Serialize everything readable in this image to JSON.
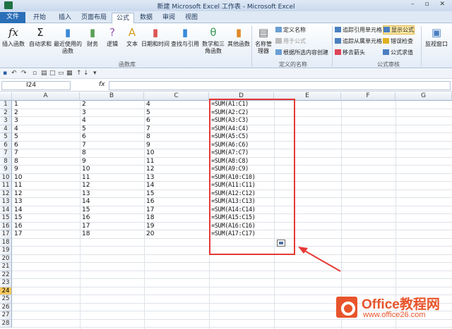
{
  "window": {
    "title": "新建 Microsoft Excel 工作表 - Microsoft Excel"
  },
  "tabs": [
    {
      "label": "文件",
      "name": "tab-file"
    },
    {
      "label": "开始",
      "name": "tab-home"
    },
    {
      "label": "插入",
      "name": "tab-insert"
    },
    {
      "label": "页面布局",
      "name": "tab-page-layout"
    },
    {
      "label": "公式",
      "name": "tab-formulas"
    },
    {
      "label": "数据",
      "name": "tab-data"
    },
    {
      "label": "审阅",
      "name": "tab-review"
    },
    {
      "label": "视图",
      "name": "tab-view"
    }
  ],
  "ribbon": {
    "insert_function": "插入函数",
    "autosum": "自动求和",
    "recent": "最近使用的函数",
    "financial": "财务",
    "logical": "逻辑",
    "text": "文本",
    "datetime": "日期和时间",
    "lookup": "查找与引用",
    "math": "数学和三角函数",
    "other": "其他函数",
    "group_library": "函数库",
    "name_manager": "名称管理器",
    "define_name": "定义名称",
    "use_in_formula": "用于公式",
    "create_from_selection": "根据所选内容创建",
    "group_names": "定义的名称",
    "trace_precedents": "追踪引用单元格",
    "trace_dependents": "追踪从属单元格",
    "remove_arrows": "移去箭头",
    "show_formulas": "显示公式",
    "error_checking": "错误检查",
    "evaluate_formula": "公式求值",
    "group_audit": "公式审核",
    "watch_window": "监视窗口"
  },
  "namebox": "I24",
  "fx": "fx",
  "columns": [
    "A",
    "B",
    "C",
    "D",
    "E",
    "F",
    "G"
  ],
  "rows": [
    {
      "n": "1",
      "a": "1",
      "b": "2",
      "c": "4",
      "d": "=SUM(A1:C1)"
    },
    {
      "n": "2",
      "a": "2",
      "b": "3",
      "c": "5",
      "d": "=SUM(A2:C2)"
    },
    {
      "n": "3",
      "a": "3",
      "b": "4",
      "c": "6",
      "d": "=SUM(A3:C3)"
    },
    {
      "n": "4",
      "a": "4",
      "b": "5",
      "c": "7",
      "d": "=SUM(A4:C4)"
    },
    {
      "n": "5",
      "a": "5",
      "b": "6",
      "c": "8",
      "d": "=SUM(A5:C5)"
    },
    {
      "n": "6",
      "a": "6",
      "b": "7",
      "c": "9",
      "d": "=SUM(A6:C6)"
    },
    {
      "n": "7",
      "a": "7",
      "b": "8",
      "c": "10",
      "d": "=SUM(A7:C7)"
    },
    {
      "n": "8",
      "a": "8",
      "b": "9",
      "c": "11",
      "d": "=SUM(A8:C8)"
    },
    {
      "n": "9",
      "a": "9",
      "b": "10",
      "c": "12",
      "d": "=SUM(A9:C9)"
    },
    {
      "n": "10",
      "a": "10",
      "b": "11",
      "c": "13",
      "d": "=SUM(A10:C10)"
    },
    {
      "n": "11",
      "a": "11",
      "b": "12",
      "c": "14",
      "d": "=SUM(A11:C11)"
    },
    {
      "n": "12",
      "a": "12",
      "b": "13",
      "c": "15",
      "d": "=SUM(A12:C12)"
    },
    {
      "n": "13",
      "a": "13",
      "b": "14",
      "c": "16",
      "d": "=SUM(A13:C13)"
    },
    {
      "n": "14",
      "a": "14",
      "b": "15",
      "c": "17",
      "d": "=SUM(A14:C14)"
    },
    {
      "n": "15",
      "a": "15",
      "b": "16",
      "c": "18",
      "d": "=SUM(A15:C15)"
    },
    {
      "n": "16",
      "a": "16",
      "b": "17",
      "c": "19",
      "d": "=SUM(A16:C16)"
    },
    {
      "n": "17",
      "a": "17",
      "b": "18",
      "c": "20",
      "d": "=SUM(A17:C17)"
    },
    {
      "n": "18",
      "a": "",
      "b": "",
      "c": "",
      "d": ""
    },
    {
      "n": "19",
      "a": "",
      "b": "",
      "c": "",
      "d": ""
    },
    {
      "n": "20",
      "a": "",
      "b": "",
      "c": "",
      "d": ""
    },
    {
      "n": "21",
      "a": "",
      "b": "",
      "c": "",
      "d": ""
    },
    {
      "n": "22",
      "a": "",
      "b": "",
      "c": "",
      "d": ""
    },
    {
      "n": "23",
      "a": "",
      "b": "",
      "c": "",
      "d": ""
    },
    {
      "n": "24",
      "a": "",
      "b": "",
      "c": "",
      "d": ""
    },
    {
      "n": "25",
      "a": "",
      "b": "",
      "c": "",
      "d": ""
    },
    {
      "n": "26",
      "a": "",
      "b": "",
      "c": "",
      "d": ""
    },
    {
      "n": "27",
      "a": "",
      "b": "",
      "c": "",
      "d": ""
    },
    {
      "n": "28",
      "a": "",
      "b": "",
      "c": "",
      "d": ""
    }
  ],
  "selected_row": "24",
  "watermark": {
    "brand": "Office教程网",
    "url": "www.office26.com"
  },
  "colors": {
    "file_tab": "#2a6fb8",
    "highlight": "#e53935",
    "watermark": "#e8542b"
  }
}
